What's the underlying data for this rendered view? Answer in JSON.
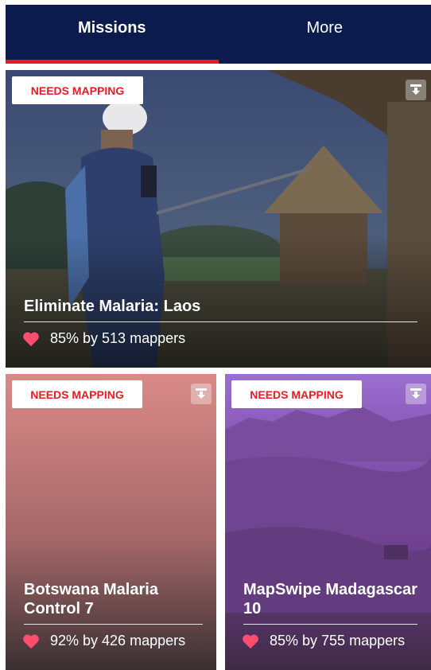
{
  "tabs": [
    {
      "label": "Missions",
      "active": true
    },
    {
      "label": "More",
      "active": false
    }
  ],
  "colors": {
    "navy": "#0c1b4d",
    "accent_red": "#e51e25",
    "heart": "#ff4d6d"
  },
  "icons": {
    "download": "download-icon",
    "heart": "heart-icon"
  },
  "missions": [
    {
      "badge": "NEEDS MAPPING",
      "title": "Eliminate Malaria: Laos",
      "stats": "85% by 513 mappers",
      "progress_percent": 85
    },
    {
      "badge": "NEEDS MAPPING",
      "title": "Botswana Malaria Control 7",
      "stats": "92% by 426 mappers",
      "progress_percent": 92
    },
    {
      "badge": "NEEDS MAPPING",
      "title": "MapSwipe Madagascar 10",
      "stats": "85% by 755 mappers",
      "progress_percent": 85
    }
  ]
}
